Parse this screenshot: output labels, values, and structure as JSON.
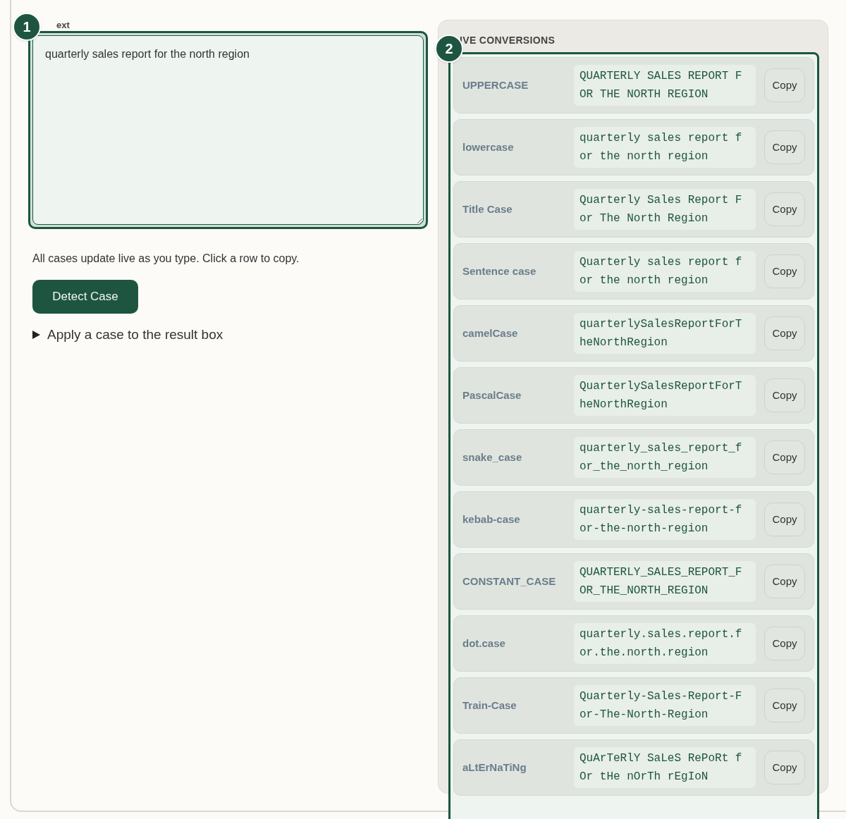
{
  "input": {
    "label": "ext",
    "value": "quarterly sales report for the north region"
  },
  "hint": "All cases update live as you type. Click a row to copy.",
  "detect_button": "Detect Case",
  "disclosure": {
    "label": "Apply a case to the result box",
    "expanded": false
  },
  "conversions": {
    "title": "IVE CONVERSIONS",
    "rows": [
      {
        "name": "UPPERCASE",
        "value": "QUARTERLY SALES REPORT FOR THE NORTH REGION",
        "button": "Copy"
      },
      {
        "name": "lowercase",
        "value": "quarterly sales report for the north region",
        "button": "Copy"
      },
      {
        "name": "Title Case",
        "value": "Quarterly Sales Report For The North Region",
        "button": "Copy"
      },
      {
        "name": "Sentence case",
        "value": "Quarterly sales report for the north region",
        "button": "Copy"
      },
      {
        "name": "camelCase",
        "value": "quarterlySalesReportForTheNorthRegion",
        "button": "Copy"
      },
      {
        "name": "PascalCase",
        "value": "QuarterlySalesReportForTheNorthRegion",
        "button": "Copy"
      },
      {
        "name": "snake_case",
        "value": "quarterly_sales_report_for_the_north_region",
        "button": "Copy"
      },
      {
        "name": "kebab-case",
        "value": "quarterly-sales-report-for-the-north-region",
        "button": "Copy"
      },
      {
        "name": "CONSTANT_CASE",
        "value": "QUARTERLY_SALES_REPORT_FOR_THE_NORTH_REGION",
        "button": "Copy"
      },
      {
        "name": "dot.case",
        "value": "quarterly.sales.report.for.the.north.region",
        "button": "Copy"
      },
      {
        "name": "Train-Case",
        "value": "Quarterly-Sales-Report-For-The-North-Region",
        "button": "Copy"
      },
      {
        "name": "aLtErNaTiNg",
        "value": "QuArTeRlY SaLeS RePoRt fOr tHe nOrTh rEgIoN",
        "button": "Copy"
      }
    ]
  },
  "annotations": [
    {
      "label": "1"
    },
    {
      "label": "2"
    }
  ]
}
